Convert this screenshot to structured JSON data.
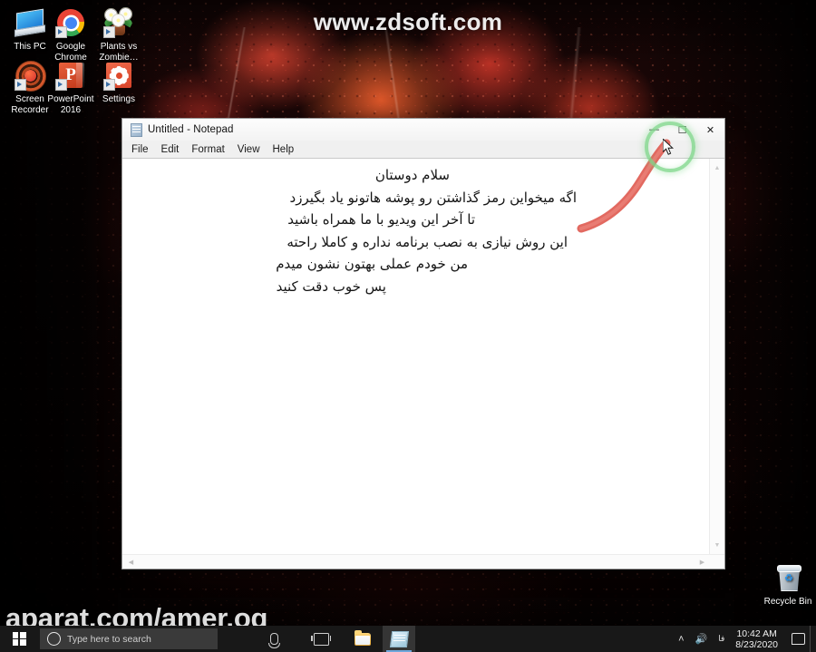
{
  "watermarks": {
    "top": "www.zdsoft.com",
    "bottom": "aparat.com/amer.oq"
  },
  "desktop": {
    "icons": [
      {
        "label": "This PC",
        "icon": "computer-icon",
        "shortcut": false
      },
      {
        "label": "Google\nChrome",
        "icon": "chrome-icon",
        "shortcut": true
      },
      {
        "label": "Plants vs\nZombie…",
        "icon": "plants-vs-zombies-icon",
        "shortcut": true
      },
      {
        "label": "Screen\nRecorder",
        "icon": "screen-recorder-icon",
        "shortcut": true
      },
      {
        "label": "PowerPoint\n2016",
        "icon": "powerpoint-icon",
        "shortcut": true,
        "glyph": "P"
      },
      {
        "label": "Settings",
        "icon": "settings-gear-icon",
        "shortcut": true
      }
    ],
    "recycle_bin": {
      "label": "Recycle Bin",
      "icon": "recycle-bin-icon"
    }
  },
  "notepad": {
    "title": "Untitled - Notepad",
    "icon": "notepad-document-icon",
    "menu": [
      "File",
      "Edit",
      "Format",
      "View",
      "Help"
    ],
    "window_controls": {
      "minimize": "—",
      "maximize": "☐",
      "close": "✕"
    },
    "content_lines": [
      "سلام دوستان",
      "اگه میخواین رمز گذاشتن رو پوشه هاتونو یاد بگیرزد",
      "تا آخر این ویدیو با ما همراه باشید",
      "این روش نیازی به نصب برنامه نداره و کاملا راحته",
      "من خودم عملی بهتون نشون میدم",
      "پس خوب دقت کنید"
    ]
  },
  "annotations": {
    "highlight_color": "#7cd688",
    "arrow_color": "#e05c52",
    "ring_target": "maximize-button"
  },
  "taskbar": {
    "start_label": "Start",
    "search_placeholder": "Type here to search",
    "pinned": [
      {
        "name": "cortana-microphone-icon",
        "active": false
      },
      {
        "name": "task-view-icon",
        "active": false
      },
      {
        "name": "file-explorer-icon",
        "active": false
      },
      {
        "name": "notepad-taskbar-icon",
        "active": true
      }
    ],
    "tray": {
      "chevron": "˄",
      "volume": "volume-icon",
      "input_indicator": "فا",
      "time": "10:42 AM",
      "date": "8/23/2020",
      "notifications": "action-center-icon"
    }
  }
}
